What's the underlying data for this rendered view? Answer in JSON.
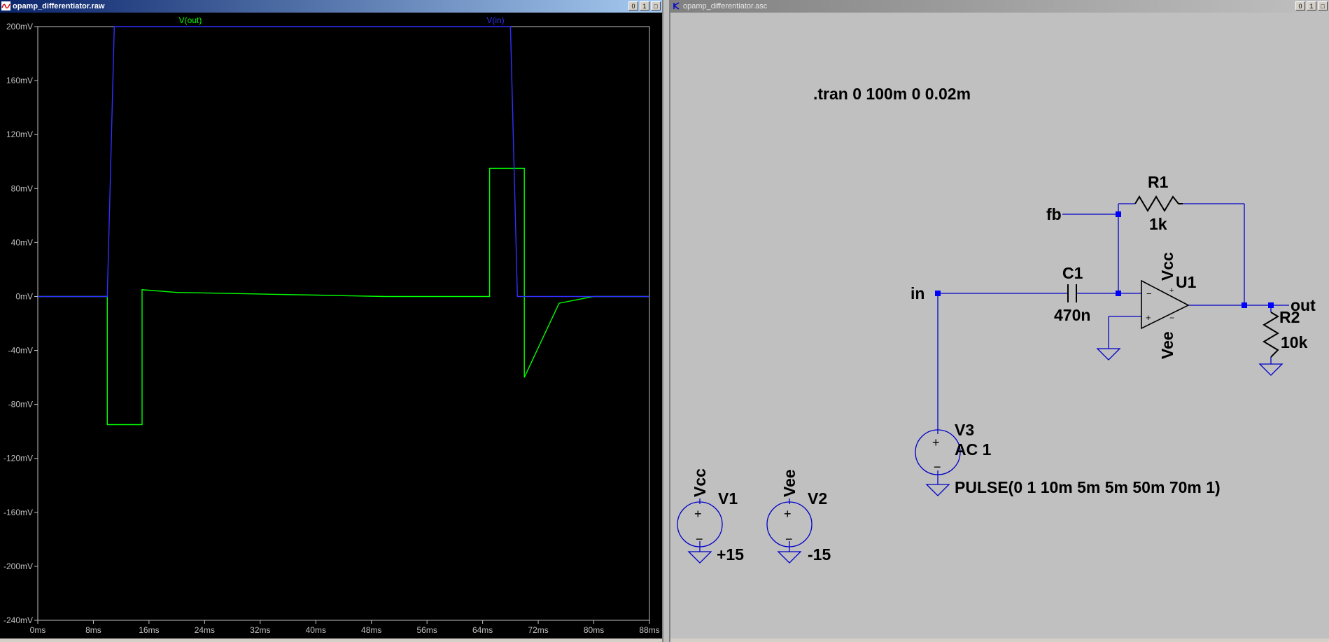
{
  "plot_window": {
    "title": "opamp_differentiator.raw",
    "buttons": [
      "0",
      "1",
      "□"
    ]
  },
  "schematic_window": {
    "title": "opamp_differentiator.asc",
    "buttons": [
      "0",
      "1",
      "□"
    ]
  },
  "chart_data": {
    "type": "line",
    "xlabel": "",
    "ylabel": "",
    "x_ticks": [
      "0ms",
      "8ms",
      "16ms",
      "24ms",
      "32ms",
      "40ms",
      "48ms",
      "56ms",
      "64ms",
      "72ms",
      "80ms",
      "88ms"
    ],
    "y_ticks": [
      "200mV",
      "160mV",
      "120mV",
      "80mV",
      "40mV",
      "0mV",
      "-40mV",
      "-80mV",
      "-120mV",
      "-160mV",
      "-200mV",
      "-240mV"
    ],
    "xlim": [
      0,
      88
    ],
    "ylim": [
      -240,
      200
    ],
    "grid": false,
    "series": [
      {
        "name": "V(out)",
        "color": "#00ff00",
        "x": [
          0,
          10,
          10,
          15,
          15,
          20,
          30,
          40,
          50,
          55,
          65,
          65,
          70,
          70,
          75,
          80,
          88
        ],
        "y": [
          0,
          0,
          -95,
          -95,
          5,
          3,
          2,
          1,
          0,
          0,
          0,
          95,
          95,
          -60,
          -5,
          0,
          0
        ]
      },
      {
        "name": "V(in)",
        "color": "#3030ff",
        "x": [
          0,
          10,
          11,
          68,
          69,
          88
        ],
        "y": [
          0,
          0,
          200,
          200,
          0,
          0
        ]
      }
    ]
  },
  "schematic": {
    "directive": ".tran 0 100m 0 0.02m",
    "net_labels": {
      "in": "in",
      "fb": "fb",
      "out": "out",
      "vcc_pin": "Vcc",
      "vee_pin": "Vee"
    },
    "components": {
      "R1": {
        "name": "R1",
        "value": "1k"
      },
      "R2": {
        "name": "R2",
        "value": "10k"
      },
      "C1": {
        "name": "C1",
        "value": "470n"
      },
      "U1": {
        "name": "U1"
      },
      "V1": {
        "name": "V1",
        "value": "+15",
        "net": "Vcc"
      },
      "V2": {
        "name": "V2",
        "value": "-15",
        "net": "Vee"
      },
      "V3": {
        "name": "V3",
        "ac": "AC 1",
        "pulse": "PULSE(0 1 10m 5m 5m 50m 70m 1)"
      }
    },
    "colors": {
      "wire": "#0000c8",
      "junction": "#0000ff",
      "background": "#c0c0c0"
    }
  }
}
